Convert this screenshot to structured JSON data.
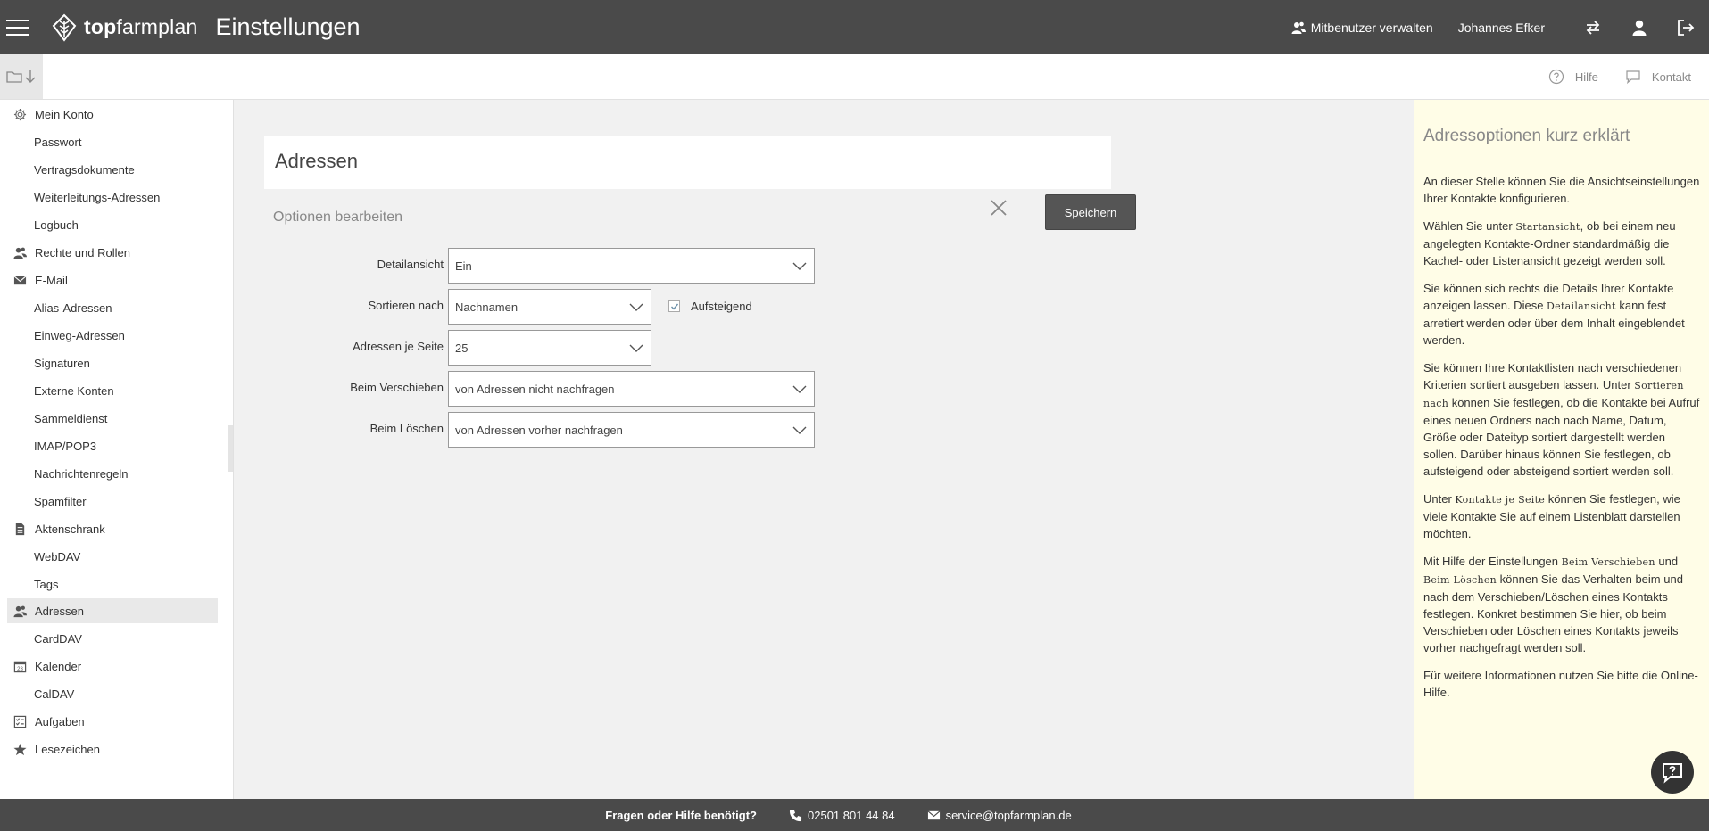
{
  "header": {
    "logo_bold": "top",
    "logo_rest": "farmplan",
    "title": "Einstellungen",
    "co_users_label": "Mitbenutzer verwalten",
    "user_name": "Johannes Efker"
  },
  "subbar": {
    "help_label": "Hilfe",
    "contact_label": "Kontakt"
  },
  "sidebar": {
    "items": [
      {
        "label": "Mein Konto",
        "icon": "gear-icon",
        "sub": false
      },
      {
        "label": "Passwort",
        "sub": true
      },
      {
        "label": "Vertragsdokumente",
        "sub": true
      },
      {
        "label": "Weiterleitungs-Adressen",
        "sub": true
      },
      {
        "label": "Logbuch",
        "sub": true
      },
      {
        "label": "Rechte und Rollen",
        "icon": "users-icon",
        "sub": false
      },
      {
        "label": "E-Mail",
        "icon": "envelope-icon",
        "sub": false
      },
      {
        "label": "Alias-Adressen",
        "sub": true
      },
      {
        "label": "Einweg-Adressen",
        "sub": true
      },
      {
        "label": "Signaturen",
        "sub": true
      },
      {
        "label": "Externe Konten",
        "sub": true
      },
      {
        "label": "Sammeldienst",
        "sub": true
      },
      {
        "label": "IMAP/POP3",
        "sub": true
      },
      {
        "label": "Nachrichtenregeln",
        "sub": true
      },
      {
        "label": "Spamfilter",
        "sub": true
      },
      {
        "label": "Aktenschrank",
        "icon": "document-icon",
        "sub": false
      },
      {
        "label": "WebDAV",
        "sub": true
      },
      {
        "label": "Tags",
        "sub": true
      },
      {
        "label": "Adressen",
        "icon": "users-icon",
        "sub": false,
        "active": true
      },
      {
        "label": "CardDAV",
        "sub": true
      },
      {
        "label": "Kalender",
        "icon": "calendar-icon",
        "sub": false
      },
      {
        "label": "CalDAV",
        "sub": true
      },
      {
        "label": "Aufgaben",
        "icon": "tasks-icon",
        "sub": false
      },
      {
        "label": "Lesezeichen",
        "icon": "star-icon",
        "sub": false
      }
    ]
  },
  "main": {
    "card_title": "Adressen",
    "options_title": "Optionen bearbeiten",
    "save_label": "Speichern",
    "fields": {
      "detail_view": {
        "label": "Detailansicht",
        "value": "Ein"
      },
      "sort_by": {
        "label": "Sortieren nach",
        "value": "Nachnamen"
      },
      "ascending": {
        "label": "Aufsteigend",
        "checked": true
      },
      "per_page": {
        "label": "Adressen je Seite",
        "value": "25"
      },
      "on_move": {
        "label": "Beim Verschieben",
        "value": "von Adressen nicht nachfragen"
      },
      "on_delete": {
        "label": "Beim Löschen",
        "value": "von Adressen vorher nachfragen"
      }
    }
  },
  "help": {
    "title": "Adressoptionen kurz erklärt",
    "p1": "An dieser Stelle können Sie die Ansichtseinstellungen Ihrer Kontakte konfigurieren.",
    "p2_a": "Wählen Sie unter ",
    "p2_kw": "Startansicht",
    "p2_b": ", ob bei einem neu angelegten Kontakte-Ordner standardmäßig die Kachel- oder Listenansicht gezeigt werden soll.",
    "p3_a": "Sie können sich rechts die Details Ihrer Kontakte anzeigen lassen. Diese ",
    "p3_kw": "Detailansicht",
    "p3_b": " kann fest arretiert werden oder über dem Inhalt eingeblendet werden.",
    "p4_a": "Sie können Ihre Kontaktlisten nach verschiedenen Kriterien sortiert ausgeben lassen. Unter ",
    "p4_kw": "Sortieren nach",
    "p4_b": " können Sie festlegen, ob die Kontakte bei Aufruf eines neuen Ordners nach nach Name, Datum, Größe oder Dateityp sortiert dargestellt werden sollen. Darüber hinaus können Sie festlegen, ob aufsteigend oder absteigend sortiert werden soll.",
    "p5_a": "Unter ",
    "p5_kw": "Kontakte je Seite",
    "p5_b": " können Sie festlegen, wie viele Kontakte Sie auf einem Listenblatt darstellen möchten.",
    "p6_a": "Mit Hilfe der Einstellungen ",
    "p6_kw1": "Beim Verschieben",
    "p6_mid": " und ",
    "p6_kw2": "Beim Löschen",
    "p6_b": " können Sie das Verhalten beim und nach dem Verschieben/Löschen eines Kontakts festlegen. Konkret bestimmen Sie hier, ob beim Verschieben oder Löschen eines Kontakts jeweils vorher nachgefragt werden soll.",
    "p7": "Für weitere Informationen nutzen Sie bitte die Online-Hilfe."
  },
  "footer": {
    "question": "Fragen oder Hilfe benötigt?",
    "phone": "02501 801 44 84",
    "email": "service@topfarmplan.de"
  }
}
